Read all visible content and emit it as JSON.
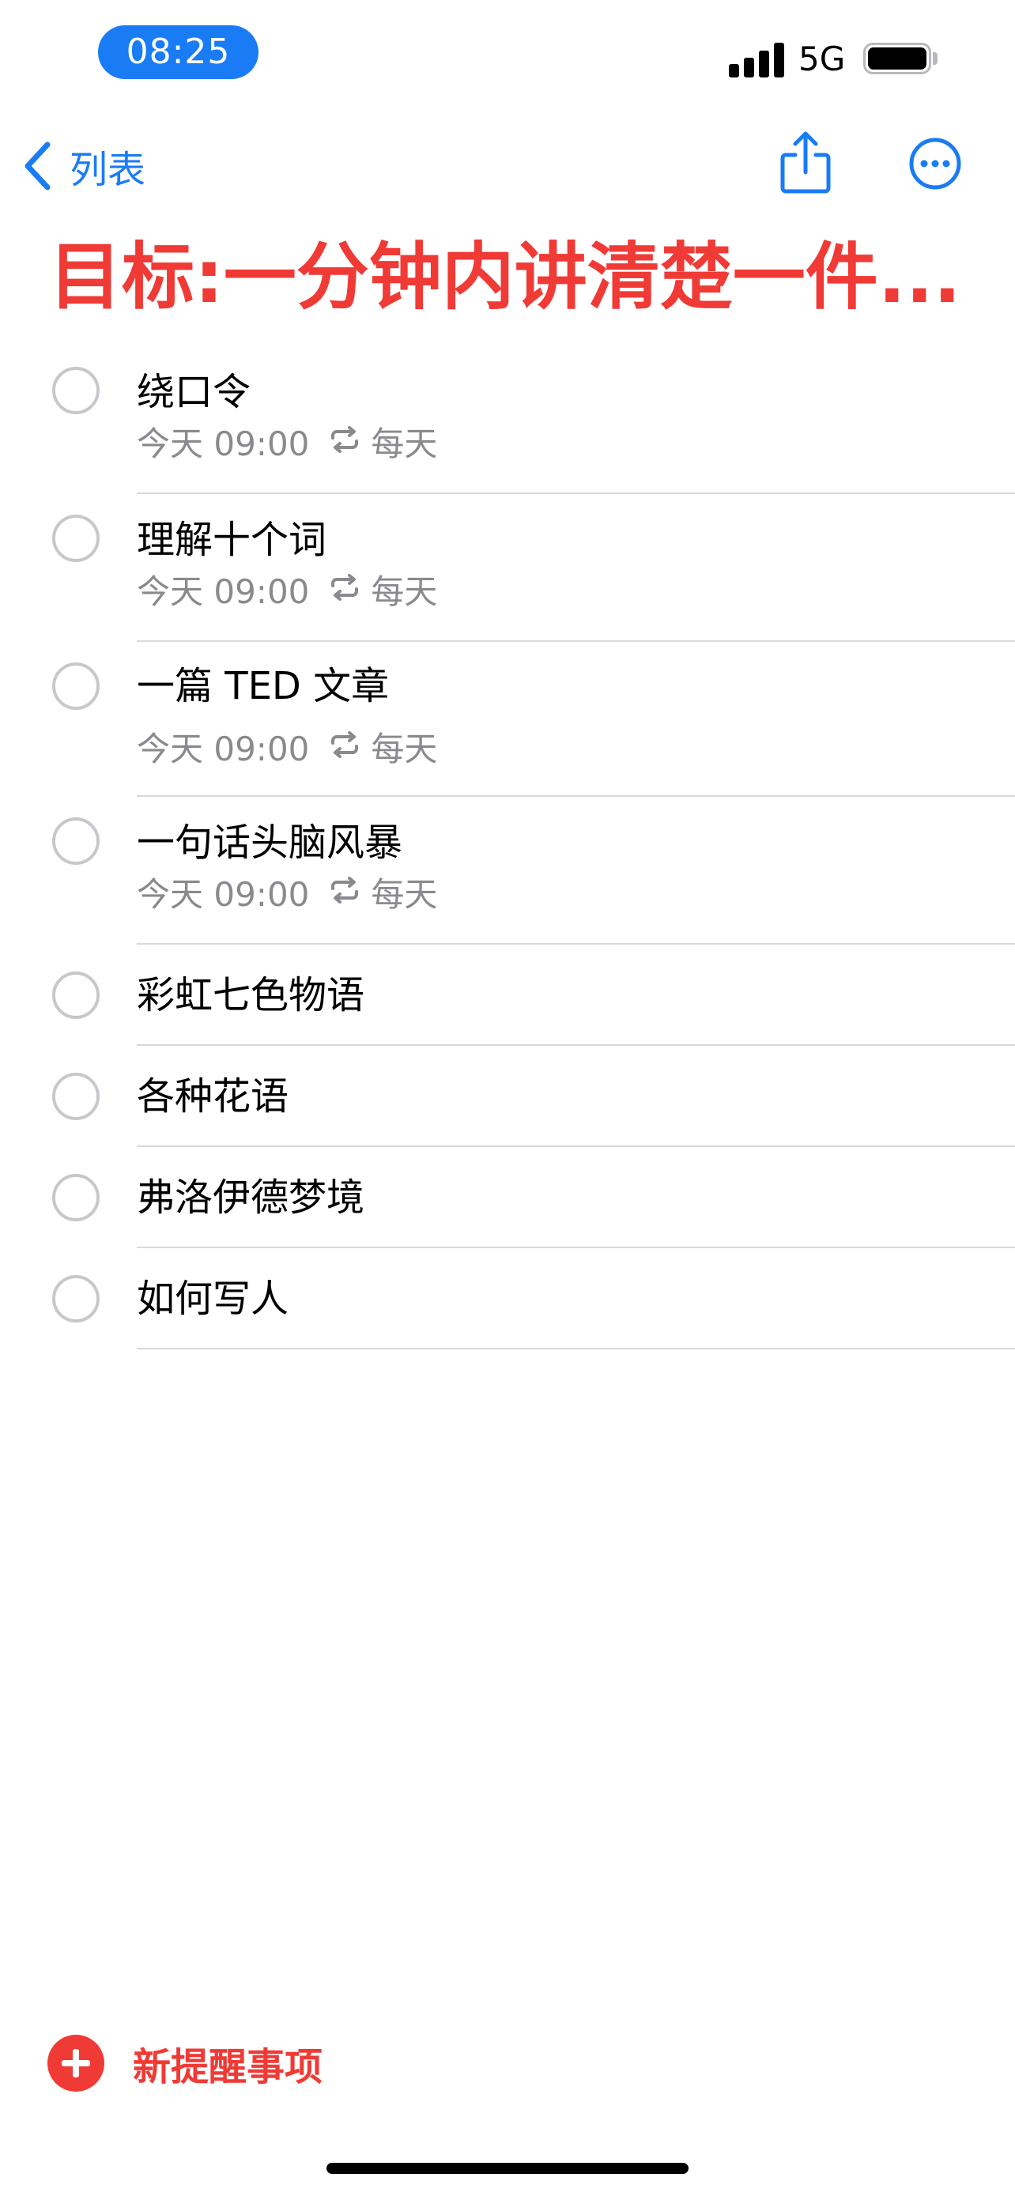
{
  "status_bar": {
    "time": "08:25",
    "network": "5G",
    "signal_bars": 4,
    "battery_level": 1.0
  },
  "nav": {
    "back_label": "列表",
    "back_icon": "chevron-left-icon",
    "share_icon": "share-icon",
    "more_icon": "ellipsis-circle-icon"
  },
  "list": {
    "title": "目标:一分钟内讲清楚一件...",
    "accent_color": "#f03a35"
  },
  "reminders": [
    {
      "title": "绕口令",
      "date": "今天 09:00",
      "repeat": "每天"
    },
    {
      "title": "理解十个词",
      "date": "今天 09:00",
      "repeat": "每天"
    },
    {
      "title": "一篇 TED 文章",
      "date": "今天 09:00",
      "repeat": "每天"
    },
    {
      "title": "一句话头脑风暴",
      "date": "今天 09:00",
      "repeat": "每天"
    },
    {
      "title": "彩虹七色物语"
    },
    {
      "title": "各种花语"
    },
    {
      "title": "弗洛伊德梦境"
    },
    {
      "title": "如何写人"
    }
  ],
  "footer": {
    "new_reminder_label": "新提醒事项"
  },
  "colors": {
    "ios_blue": "#1a7cf5",
    "red": "#f03a35",
    "secondary_text": "#8a8a8e",
    "separator": "#d9d9dc"
  }
}
